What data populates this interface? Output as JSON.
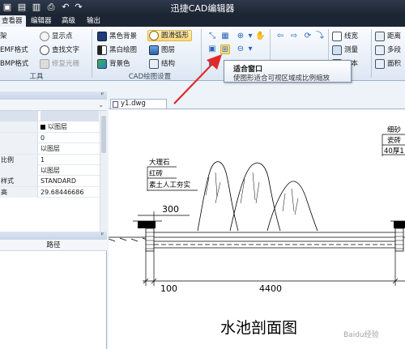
{
  "app": {
    "title": "迅捷CAD编辑器"
  },
  "tabs": [
    {
      "label": "查看器",
      "active": true
    },
    {
      "label": "编辑器",
      "active": false
    },
    {
      "label": "高级",
      "active": false
    },
    {
      "label": "输出",
      "active": false
    }
  ],
  "ribbon": {
    "tools_group": {
      "label": "工具",
      "items": [
        "架",
        "EMF格式",
        "BMP格式",
        "显示点",
        "查找文字",
        "修复光栅"
      ]
    },
    "cad_settings_group": {
      "label": "CAD绘图设置",
      "items": [
        "黑色背景",
        "黑白绘图",
        "背景色",
        "圆滑弧形",
        "图层",
        "结构"
      ]
    },
    "right_items": [
      "线宽",
      "测量",
      "文本",
      "距离",
      "多段",
      "面积"
    ]
  },
  "tooltip": {
    "title": "适合窗口",
    "description": "使图形适合可视区域成比例缩放"
  },
  "left_panel": {
    "properties": [
      {
        "name": "",
        "value": "",
        "section": true
      },
      {
        "name": "",
        "value": "以图层",
        "swatch": true
      },
      {
        "name": "",
        "value": "0"
      },
      {
        "name": "",
        "value": "以图层"
      },
      {
        "name": "比例",
        "value": "1"
      },
      {
        "name": "",
        "value": "以图层"
      },
      {
        "name": "样式",
        "value": "STANDARD"
      },
      {
        "name": "高",
        "value": "29.68446686"
      }
    ],
    "path_column": "路径"
  },
  "document": {
    "tab": "y1.dwg"
  },
  "drawing": {
    "labels": {
      "marble": "大理石",
      "red_brick": "红砖",
      "soil": "素土人工夯实",
      "fine_sand": "细砂",
      "tile": "瓷砖",
      "cement": "40厚1",
      "dim_300": "300",
      "dim_100": "100",
      "dim_4400": "4400",
      "title": "水池剖面图"
    }
  },
  "watermark": "Baidu经验",
  "colors": {
    "accent_red": "#e02a2a",
    "ribbon_highlight": "#ffd97a",
    "titlebar": "#1c2533"
  }
}
